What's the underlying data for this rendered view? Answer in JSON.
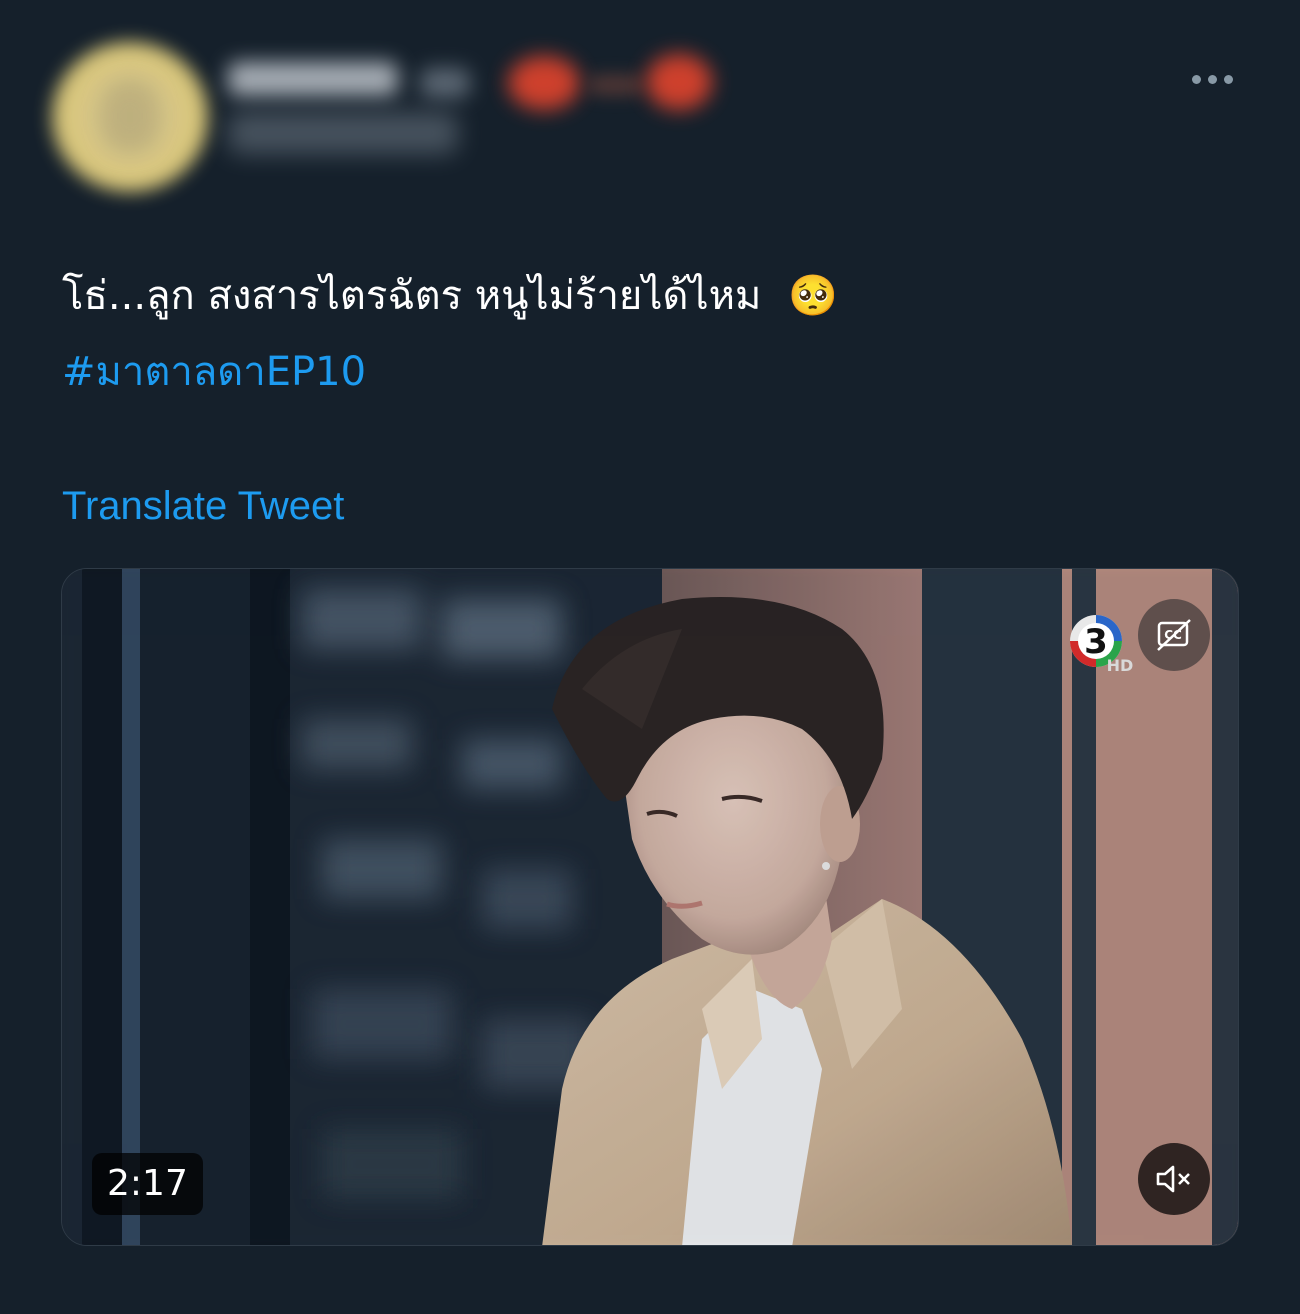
{
  "tweet": {
    "text_line": "โธ่...ลูก สงสารไตรฉัตร หนูไม่ร้ายได้ไหม",
    "emoji": "🥺",
    "hashtag": "#มาตาลดาEP10",
    "translate_label": "Translate Tweet"
  },
  "media": {
    "duration": "2:17",
    "channel_logo_text": "3",
    "channel_logo_badge": "HD",
    "captions_icon": "cc-icon",
    "mute_icon": "speaker-muted-icon"
  },
  "header": {
    "more_icon": "more-horizontal-icon"
  },
  "colors": {
    "background": "#15202b",
    "link": "#1d9bf0",
    "text": "#ffffff"
  }
}
